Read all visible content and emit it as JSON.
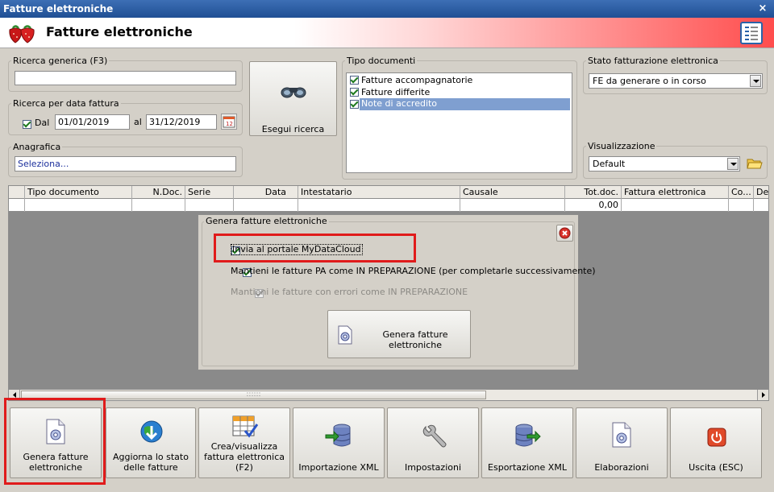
{
  "window": {
    "title": "Fatture elettroniche",
    "close": "×"
  },
  "header": {
    "title": "Fatture elettroniche"
  },
  "search": {
    "generic_legend": "Ricerca generica (F3)",
    "generic_value": "",
    "date_legend": "Ricerca per data fattura",
    "dal_label": "Dal",
    "dal_checked": true,
    "date_from": "01/01/2019",
    "al_label": "al",
    "date_to": "31/12/2019",
    "anagrafica_legend": "Anagrafica",
    "anagrafica_value": "Seleziona...",
    "search_button": "Esegui ricerca"
  },
  "tipo_documenti": {
    "legend": "Tipo documenti",
    "items": [
      {
        "label": "Fatture accompagnatorie",
        "checked": true
      },
      {
        "label": "Fatture differite",
        "checked": true
      },
      {
        "label": "Note di accredito",
        "checked": true,
        "selected": true
      }
    ]
  },
  "stato": {
    "legend": "Stato fatturazione elettronica",
    "value": "FE da generare o in corso"
  },
  "visualizzazione": {
    "legend": "Visualizzazione",
    "value": "Default"
  },
  "grid": {
    "columns": [
      "Tipo documento",
      "N.Doc.",
      "Serie",
      "Data",
      "Intestatario",
      "Causale",
      "Tot.doc.",
      "Fattura elettronica",
      "Co...",
      "Des"
    ],
    "row_total": "0,00"
  },
  "dialog": {
    "title": "Genera fatture elettroniche",
    "options": [
      {
        "label": "Invia al portale MyDataCloud",
        "checked": true,
        "enabled": true
      },
      {
        "label": "Mantieni le fatture PA come IN PREPARAZIONE (per completarle successivamente)",
        "checked": true,
        "enabled": true
      },
      {
        "label": "Mantieni le fatture con errori come IN PREPARAZIONE",
        "checked": true,
        "enabled": false
      }
    ],
    "generate_button": "Genera fatture elettroniche"
  },
  "toolbar": [
    {
      "label": "Genera fatture elettroniche",
      "icon": "document-gear-icon"
    },
    {
      "label": "Aggiorna lo stato delle fatture",
      "icon": "globe-download-icon"
    },
    {
      "label": "Crea/visualizza fattura elettronica (F2)",
      "icon": "table-check-icon"
    },
    {
      "label": "Importazione XML",
      "icon": "database-import-icon"
    },
    {
      "label": "Impostazioni",
      "icon": "wrench-icon"
    },
    {
      "label": "Esportazione XML",
      "icon": "database-export-icon"
    },
    {
      "label": "Elaborazioni",
      "icon": "document-gear-icon"
    },
    {
      "label": "Uscita (ESC)",
      "icon": "power-icon"
    }
  ],
  "colors": {
    "accent_red": "#e01b1b",
    "titlebar_blue": "#2a5ea4",
    "selection_blue": "#7f9fd0"
  }
}
